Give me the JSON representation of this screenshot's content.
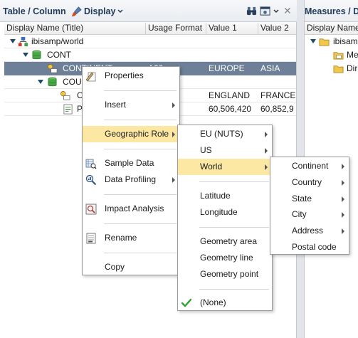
{
  "left_panel": {
    "title": "Table / Column",
    "display_label": "Display",
    "columns": [
      "Display Name (Title)",
      "Usage Format",
      "Value 1",
      "Value 2"
    ],
    "rows": [
      {
        "name": "ibisamp/world",
        "usage": "",
        "v1": "",
        "v2": ""
      },
      {
        "name": "CONT",
        "usage": "",
        "v1": "",
        "v2": ""
      },
      {
        "name": "CONTINENT",
        "usage": "A20",
        "v1": "EUROPE",
        "v2": "ASIA"
      },
      {
        "name": "COUNTRY",
        "usage": "",
        "v1": "",
        "v2": ""
      },
      {
        "name": "C",
        "usage": "",
        "v1": "ENGLAND",
        "v2": "FRANCE"
      },
      {
        "name": "P",
        "usage": "",
        "v1": "60,506,420",
        "v2": "60,852,9"
      }
    ]
  },
  "right_panel": {
    "title": "Measures / D",
    "column": "Display Name",
    "items": [
      "ibisamp",
      "Me",
      "Dir"
    ]
  },
  "menu1": {
    "items": {
      "properties": "Properties",
      "insert": "Insert",
      "geographic_role": "Geographic Role",
      "sample_data": "Sample Data",
      "data_profiling": "Data Profiling",
      "impact_analysis": "Impact Analysis",
      "rename": "Rename",
      "copy": "Copy"
    }
  },
  "menu2": {
    "items": {
      "eu_nuts": "EU (NUTS)",
      "us": "US",
      "world": "World",
      "latitude": "Latitude",
      "longitude": "Longitude",
      "geometry_area": "Geometry area",
      "geometry_line": "Geometry line",
      "geometry_point": "Geometry point",
      "none": "(None)"
    }
  },
  "menu3": {
    "items": {
      "continent": "Continent",
      "country": "Country",
      "state": "State",
      "city": "City",
      "address": "Address",
      "postal_code": "Postal code"
    }
  },
  "colors": {
    "selected_row": "#6d8097",
    "menu_highlight": "#fce8a2",
    "header_text": "#1f3a5a",
    "check": "#2ea02e"
  },
  "icons": [
    "display-brush-icon",
    "binoculars-icon",
    "view-options-icon",
    "close-icon",
    "database-hierarchy-icon",
    "segment-icon",
    "key-field-icon",
    "properties-icon",
    "sample-data-icon",
    "data-profiling-icon",
    "impact-analysis-icon",
    "rename-icon",
    "checkmark-icon",
    "folder-icon"
  ]
}
